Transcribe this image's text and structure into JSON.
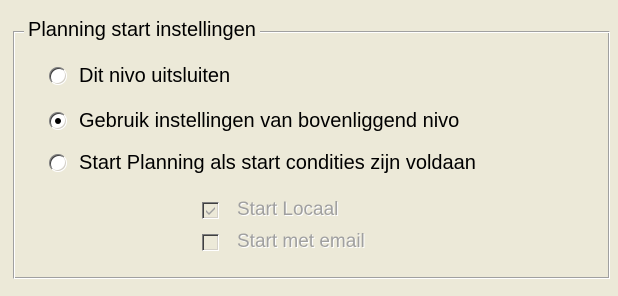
{
  "group": {
    "title": "Planning start instellingen"
  },
  "options": [
    {
      "label": "Dit nivo uitsluiten",
      "checked": false
    },
    {
      "label": "Gebruik instellingen van bovenliggend nivo",
      "checked": true
    },
    {
      "label": "Start Planning als start condities zijn voldaan",
      "checked": false
    }
  ],
  "checkboxes": [
    {
      "label": "Start Locaal",
      "checked": true,
      "enabled": false
    },
    {
      "label": "Start met email",
      "checked": false,
      "enabled": false
    }
  ]
}
